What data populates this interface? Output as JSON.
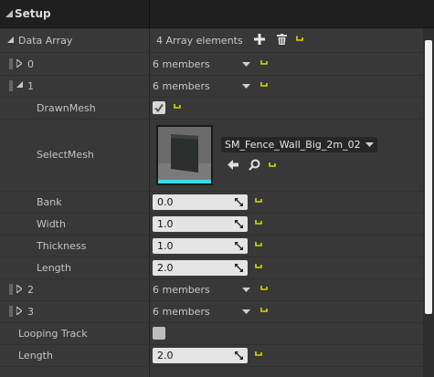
{
  "header": {
    "title": "Setup"
  },
  "data_array": {
    "label": "Data Array",
    "count_text": "4 Array elements",
    "items": [
      {
        "index": "0",
        "summary": "6 members"
      },
      {
        "index": "1",
        "summary": "6 members"
      },
      {
        "index": "2",
        "summary": "6 members"
      },
      {
        "index": "3",
        "summary": "6 members"
      }
    ]
  },
  "element1": {
    "drawn_mesh_label": "DrawnMesh",
    "drawn_mesh_checked": true,
    "select_mesh_label": "SelectMesh",
    "select_mesh_value": "SM_Fence_Wall_Big_2m_02",
    "bank_label": "Bank",
    "bank_value": "0.0",
    "width_label": "Width",
    "width_value": "1.0",
    "thickness_label": "Thickness",
    "thickness_value": "1.0",
    "length_label": "Length",
    "length_value": "2.0"
  },
  "looping_track": {
    "label": "Looping Track",
    "checked": false
  },
  "length": {
    "label": "Length",
    "value": "2.0"
  },
  "colors": {
    "reset": "#d8d800",
    "header_bg": "#1f1f1f",
    "panel_bg": "#383838",
    "thumb_accent": "#3fd6e8"
  }
}
